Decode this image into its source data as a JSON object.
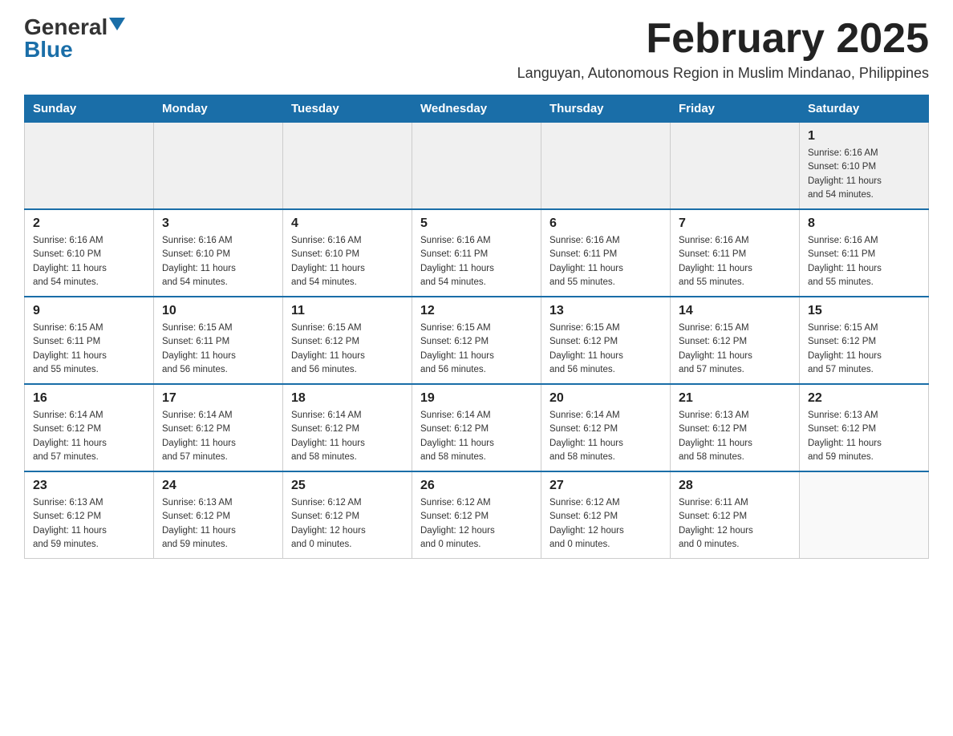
{
  "logo": {
    "general": "General",
    "blue": "Blue"
  },
  "title": "February 2025",
  "subtitle": "Languyan, Autonomous Region in Muslim Mindanao, Philippines",
  "days_of_week": [
    "Sunday",
    "Monday",
    "Tuesday",
    "Wednesday",
    "Thursday",
    "Friday",
    "Saturday"
  ],
  "weeks": [
    [
      {
        "day": "",
        "info": ""
      },
      {
        "day": "",
        "info": ""
      },
      {
        "day": "",
        "info": ""
      },
      {
        "day": "",
        "info": ""
      },
      {
        "day": "",
        "info": ""
      },
      {
        "day": "",
        "info": ""
      },
      {
        "day": "1",
        "info": "Sunrise: 6:16 AM\nSunset: 6:10 PM\nDaylight: 11 hours\nand 54 minutes."
      }
    ],
    [
      {
        "day": "2",
        "info": "Sunrise: 6:16 AM\nSunset: 6:10 PM\nDaylight: 11 hours\nand 54 minutes."
      },
      {
        "day": "3",
        "info": "Sunrise: 6:16 AM\nSunset: 6:10 PM\nDaylight: 11 hours\nand 54 minutes."
      },
      {
        "day": "4",
        "info": "Sunrise: 6:16 AM\nSunset: 6:10 PM\nDaylight: 11 hours\nand 54 minutes."
      },
      {
        "day": "5",
        "info": "Sunrise: 6:16 AM\nSunset: 6:11 PM\nDaylight: 11 hours\nand 54 minutes."
      },
      {
        "day": "6",
        "info": "Sunrise: 6:16 AM\nSunset: 6:11 PM\nDaylight: 11 hours\nand 55 minutes."
      },
      {
        "day": "7",
        "info": "Sunrise: 6:16 AM\nSunset: 6:11 PM\nDaylight: 11 hours\nand 55 minutes."
      },
      {
        "day": "8",
        "info": "Sunrise: 6:16 AM\nSunset: 6:11 PM\nDaylight: 11 hours\nand 55 minutes."
      }
    ],
    [
      {
        "day": "9",
        "info": "Sunrise: 6:15 AM\nSunset: 6:11 PM\nDaylight: 11 hours\nand 55 minutes."
      },
      {
        "day": "10",
        "info": "Sunrise: 6:15 AM\nSunset: 6:11 PM\nDaylight: 11 hours\nand 56 minutes."
      },
      {
        "day": "11",
        "info": "Sunrise: 6:15 AM\nSunset: 6:12 PM\nDaylight: 11 hours\nand 56 minutes."
      },
      {
        "day": "12",
        "info": "Sunrise: 6:15 AM\nSunset: 6:12 PM\nDaylight: 11 hours\nand 56 minutes."
      },
      {
        "day": "13",
        "info": "Sunrise: 6:15 AM\nSunset: 6:12 PM\nDaylight: 11 hours\nand 56 minutes."
      },
      {
        "day": "14",
        "info": "Sunrise: 6:15 AM\nSunset: 6:12 PM\nDaylight: 11 hours\nand 57 minutes."
      },
      {
        "day": "15",
        "info": "Sunrise: 6:15 AM\nSunset: 6:12 PM\nDaylight: 11 hours\nand 57 minutes."
      }
    ],
    [
      {
        "day": "16",
        "info": "Sunrise: 6:14 AM\nSunset: 6:12 PM\nDaylight: 11 hours\nand 57 minutes."
      },
      {
        "day": "17",
        "info": "Sunrise: 6:14 AM\nSunset: 6:12 PM\nDaylight: 11 hours\nand 57 minutes."
      },
      {
        "day": "18",
        "info": "Sunrise: 6:14 AM\nSunset: 6:12 PM\nDaylight: 11 hours\nand 58 minutes."
      },
      {
        "day": "19",
        "info": "Sunrise: 6:14 AM\nSunset: 6:12 PM\nDaylight: 11 hours\nand 58 minutes."
      },
      {
        "day": "20",
        "info": "Sunrise: 6:14 AM\nSunset: 6:12 PM\nDaylight: 11 hours\nand 58 minutes."
      },
      {
        "day": "21",
        "info": "Sunrise: 6:13 AM\nSunset: 6:12 PM\nDaylight: 11 hours\nand 58 minutes."
      },
      {
        "day": "22",
        "info": "Sunrise: 6:13 AM\nSunset: 6:12 PM\nDaylight: 11 hours\nand 59 minutes."
      }
    ],
    [
      {
        "day": "23",
        "info": "Sunrise: 6:13 AM\nSunset: 6:12 PM\nDaylight: 11 hours\nand 59 minutes."
      },
      {
        "day": "24",
        "info": "Sunrise: 6:13 AM\nSunset: 6:12 PM\nDaylight: 11 hours\nand 59 minutes."
      },
      {
        "day": "25",
        "info": "Sunrise: 6:12 AM\nSunset: 6:12 PM\nDaylight: 12 hours\nand 0 minutes."
      },
      {
        "day": "26",
        "info": "Sunrise: 6:12 AM\nSunset: 6:12 PM\nDaylight: 12 hours\nand 0 minutes."
      },
      {
        "day": "27",
        "info": "Sunrise: 6:12 AM\nSunset: 6:12 PM\nDaylight: 12 hours\nand 0 minutes."
      },
      {
        "day": "28",
        "info": "Sunrise: 6:11 AM\nSunset: 6:12 PM\nDaylight: 12 hours\nand 0 minutes."
      },
      {
        "day": "",
        "info": ""
      }
    ]
  ]
}
